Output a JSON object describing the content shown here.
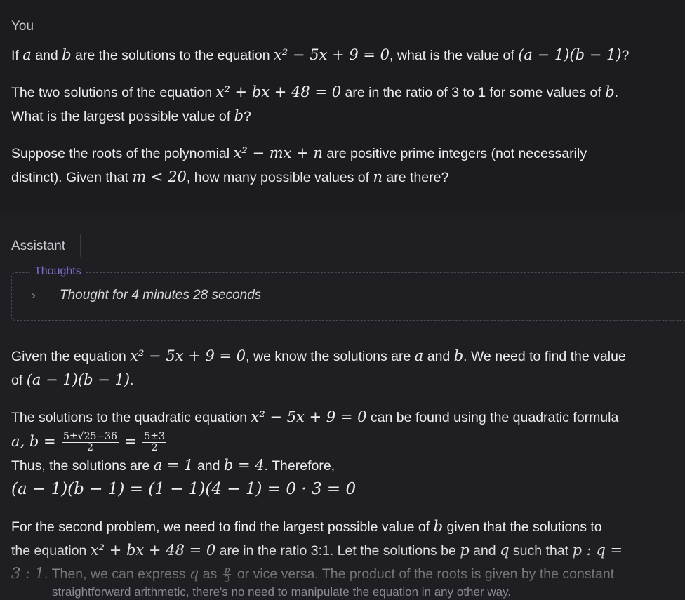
{
  "user": {
    "role": "You",
    "q1": {
      "t1": "If ",
      "v_a": "a",
      "t2": " and ",
      "v_b": "b",
      "t3": " are the solutions to the equation ",
      "eq": "x² − 5x + 9 = 0",
      "t4": ", what is the value of ",
      "expr": "(a − 1)(b − 1)",
      "t5": "?"
    },
    "q2": {
      "l1a": "The two solutions of the equation ",
      "eq": "x² + bx + 48 = 0",
      "l1b": " are in the ratio of 3 to 1 for some values of ",
      "v_b": "b",
      "l1c": ".",
      "l2a": "What is the largest possible value of ",
      "l2b": "?"
    },
    "q3": {
      "l1a": "Suppose the roots of the polynomial ",
      "eq": "x² − mx + n",
      "l1b": " are positive prime integers (not necessarily",
      "l2a": "distinct). Given that ",
      "cond": "m < 20",
      "l2b": ", how many possible values of ",
      "v_n": "n",
      "l2c": " are there?"
    }
  },
  "assistant": {
    "role": "Assistant",
    "thoughts_label": "Thoughts",
    "thoughts_summary": "Thought for 4 minutes 28 seconds",
    "p1": {
      "l1a": "Given the equation ",
      "eq": "x² − 5x + 9 = 0",
      "l1b": ", we know the solutions are ",
      "v_a": "a",
      "l1c": " and ",
      "v_b": "b",
      "l1d": ". We need to find the value",
      "l2a": "of ",
      "expr": "(a − 1)(b − 1)",
      "l2b": "."
    },
    "p2": {
      "l1a": "The solutions to the quadratic equation ",
      "eq": "x² − 5x + 9 = 0",
      "l1b": " can be found using the quadratic formula",
      "lhs": "a, b =",
      "f1_num": "5±√25−36",
      "f1_den": "2",
      "eq_sign": "=",
      "f2_num": "5±3",
      "f2_den": "2",
      "l3a": "Thus, the solutions are ",
      "sol_a": "a = 1",
      "l3b": " and ",
      "sol_b": "b = 4",
      "l3c": ". Therefore,",
      "result": "(a − 1)(b − 1) = (1 − 1)(4 − 1) = 0 · 3 = 0"
    },
    "p3": {
      "l1a": "For the second problem, we need to find the largest possible value of ",
      "v_b": "b",
      "l1b": " given that the solutions to",
      "l2a": "the equation ",
      "eq": "x² + bx + 48 = 0",
      "l2b": " are in the ratio 3:1. Let the solutions be ",
      "v_p": "p",
      "l2c": " and ",
      "v_q": "q",
      "l2d": " such that ",
      "ratio_a": "p : q =",
      "ratio_b": "3 : 1",
      "l3a": ". Then, we can express ",
      "l3b": " as ",
      "f_num": "p",
      "f_den": "3",
      "l3c": " or vice versa. The product of the roots is given by the constant",
      "l4": "straightforward arithmetic, there's no need to manipulate the equation in any other way."
    }
  }
}
